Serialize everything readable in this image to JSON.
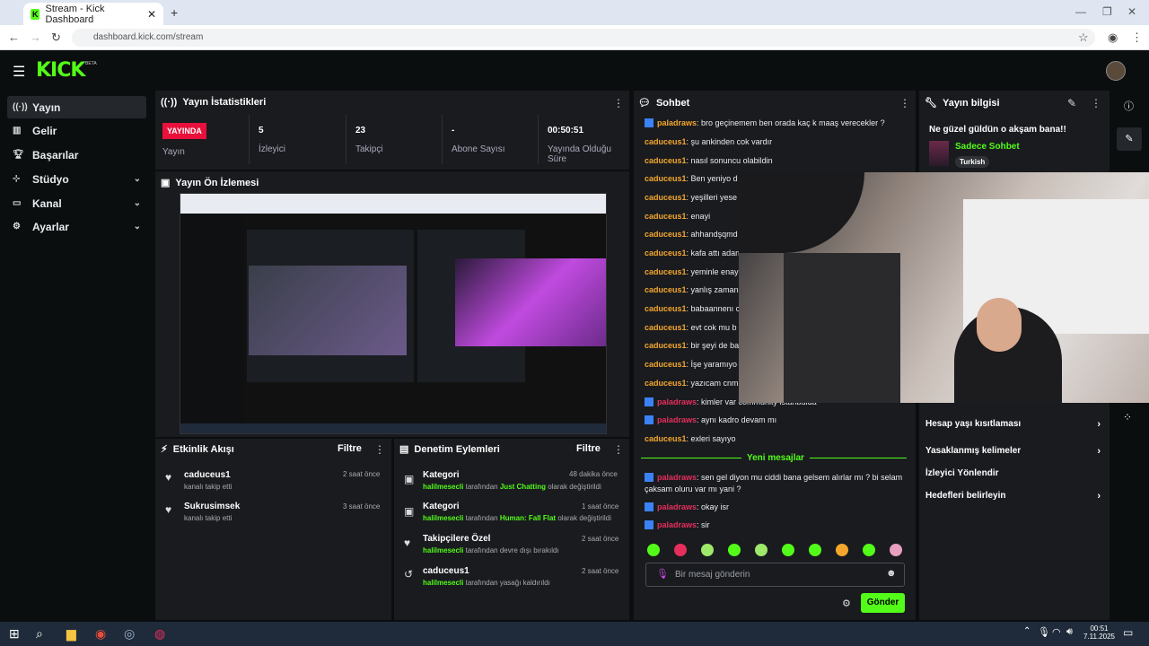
{
  "browser": {
    "tab_title": "Stream - Kick Dashboard",
    "url": "dashboard.kick.com/stream"
  },
  "header": {
    "logo": "KICK",
    "beta": "BETA"
  },
  "sidebar": {
    "items": [
      {
        "label": "Yayın",
        "icon": "broadcast-icon",
        "active": true
      },
      {
        "label": "Gelir",
        "icon": "revenue-icon"
      },
      {
        "label": "Başarılar",
        "icon": "trophy-icon"
      },
      {
        "label": "Stüdyo",
        "icon": "studio-icon",
        "expandable": true
      },
      {
        "label": "Kanal",
        "icon": "channel-icon",
        "expandable": true
      },
      {
        "label": "Ayarlar",
        "icon": "settings-icon",
        "expandable": true
      }
    ]
  },
  "stats": {
    "title": "Yayın İstatistikleri",
    "live_badge": "YAYINDA",
    "live_label": "Yayın",
    "viewers_value": "5",
    "viewers_label": "İzleyici",
    "followers_value": "23",
    "followers_label": "Takipçi",
    "subs_value": "-",
    "subs_label": "Abone Sayısı",
    "duration_value": "00:50:51",
    "duration_label": "Yayında Olduğu Süre"
  },
  "preview": {
    "title": "Yayın Ön İzlemesi"
  },
  "activity": {
    "title": "Etkinlik Akışı",
    "filter": "Filtre",
    "items": [
      {
        "name": "caduceus1",
        "sub": "kanalı takip etti",
        "time": "2 saat önce"
      },
      {
        "name": "Sukrusimsek",
        "sub": "kanalı takip etti",
        "time": "3 saat önce"
      }
    ]
  },
  "moderation": {
    "title": "Denetim Eylemleri",
    "filter": "Filtre",
    "items": [
      {
        "title": "Kategori",
        "actor": "halilmesecli",
        "mid": "tarafından",
        "target": "Just Chatting",
        "end": "olarak değiştirildi",
        "time": "48 dakika önce"
      },
      {
        "title": "Kategori",
        "actor": "halilmesecli",
        "mid": "tarafından",
        "target": "Human: Fall Flat",
        "end": "olarak değiştirildi",
        "time": "1 saat önce"
      },
      {
        "title": "Takipçilere Özel",
        "actor": "halilmesecli",
        "mid": "tarafından devre dışı bırakıldı",
        "target": "",
        "end": "",
        "time": "2 saat önce"
      },
      {
        "title": "caduceus1",
        "actor": "halilmesecli",
        "mid": "tarafından yasağı kaldırıldı",
        "target": "",
        "end": "",
        "time": "2 saat önce"
      }
    ]
  },
  "chat": {
    "title": "Sohbet",
    "messages": [
      {
        "user": "paladraws",
        "badge": true,
        "color": "#f4a72c",
        "text": "bro geçinemem ben orada kaç k maaş verecekler ?"
      },
      {
        "user": "caduceus1",
        "text": "şu ankinden cok vardır"
      },
      {
        "user": "caduceus1",
        "text": "nasıl sonuncu olabildin"
      },
      {
        "user": "caduceus1",
        "text": "Ben yeniyo d"
      },
      {
        "user": "caduceus1",
        "text": "yeşilleri yese"
      },
      {
        "user": "caduceus1",
        "text": "enayi"
      },
      {
        "user": "caduceus1",
        "text": "ahhandşqmd"
      },
      {
        "user": "caduceus1",
        "text": "kafa attı adan"
      },
      {
        "user": "caduceus1",
        "text": "yeminle enay"
      },
      {
        "user": "caduceus1",
        "text": "yanlış zaman"
      },
      {
        "user": "caduceus1",
        "text": "babaannenı c"
      },
      {
        "user": "caduceus1",
        "text": "evt cok mu b"
      },
      {
        "user": "caduceus1",
        "text": "bir şeyi de ba"
      },
      {
        "user": "caduceus1",
        "text": "İşe yaramıyo"
      },
      {
        "user": "caduceus1",
        "text": "yazıcam cnm"
      },
      {
        "user": "paladraws",
        "badge": true,
        "color": "#e62e5c",
        "text": "kimler var community istanbulda"
      },
      {
        "user": "paladraws",
        "badge": true,
        "color": "#e62e5c",
        "text": "aynı kadro devam mı"
      },
      {
        "user": "caduceus1",
        "text": "exleri sayıyo"
      }
    ],
    "new_divider": "Yeni mesajlar",
    "new_messages": [
      {
        "user": "paladraws",
        "badge": true,
        "text": "sen gel diyon mu ciddi bana gelsem alırlar mı ? bi selam çaksam oluru var mı yani ?"
      },
      {
        "user": "paladraws",
        "badge": true,
        "text": "okay isr"
      },
      {
        "user": "paladraws",
        "badge": true,
        "text": "sir"
      }
    ],
    "input_placeholder": "Bir mesaj gönderin",
    "send_label": "Gönder"
  },
  "info": {
    "title": "Yayın bilgisi",
    "stream_title": "Ne güzel güldün o akşam bana!!",
    "category": "Sadece Sohbet",
    "language": "Turkish",
    "menu": [
      {
        "label": "Hesap yaşı kısıtlaması",
        "arrow": true
      },
      {
        "label": "Yasaklanmış kelimeler",
        "arrow": true
      },
      {
        "label": "İzleyici Yönlendir",
        "arrow": false
      },
      {
        "label": "Hedefleri belirleyin",
        "arrow": true
      }
    ]
  },
  "taskbar": {
    "time": "00:51",
    "date": "7.11.2025"
  },
  "colors": {
    "accent": "#53fc18",
    "live": "#e9113c",
    "panel": "#191b1f",
    "background": "#0b0e0f"
  }
}
